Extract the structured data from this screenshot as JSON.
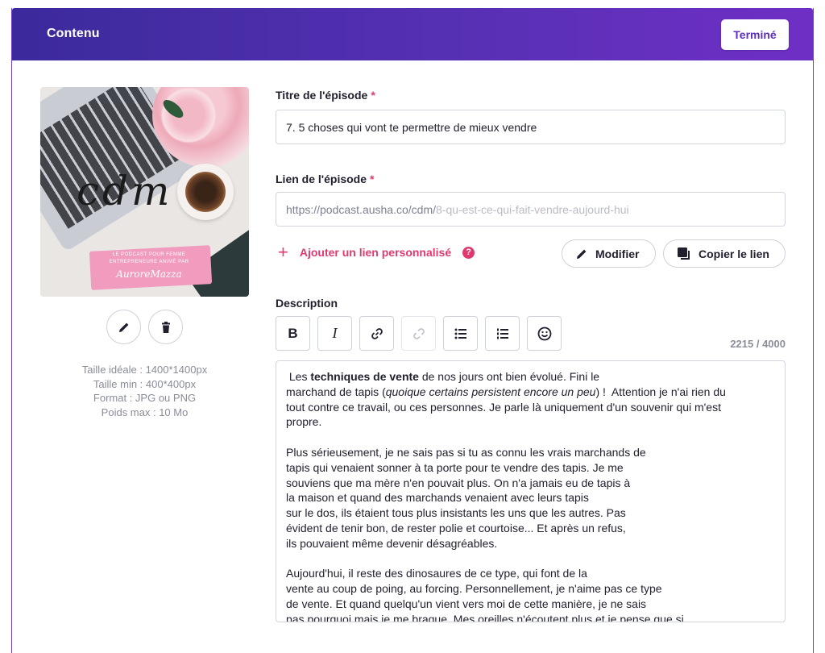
{
  "header": {
    "title": "Contenu",
    "done_label": "Terminé"
  },
  "cover": {
    "logo_text": "cdm",
    "tagline_line1": "LE PODCAST POUR FEMME",
    "tagline_line2": "ENTREPRENEURE ANIMÉ PAR",
    "author": "AuroreMazza"
  },
  "image_info": {
    "ideal_size": "Taille idéale : 1400*1400px",
    "min_size": "Taille min : 400*400px",
    "format": "Format : JPG ou PNG",
    "max_weight": "Poids max : 10 Mo"
  },
  "title_field": {
    "label": "Titre de l'épisode",
    "required_mark": "*",
    "value": "7. 5 choses qui vont te permettre de mieux vendre"
  },
  "link_field": {
    "label": "Lien de l'épisode",
    "required_mark": "*",
    "prefix": "https://podcast.ausha.co/cdm/",
    "suffix": "8-qu-est-ce-qui-fait-vendre-aujourd-hui"
  },
  "actions": {
    "add_custom_link": "Ajouter un lien personnalisé",
    "help": "?",
    "modify": "Modifier",
    "copy_link": "Copier le lien"
  },
  "description": {
    "label": "Description",
    "counter": "2215 / 4000",
    "toolbar": [
      "bold",
      "italic",
      "link",
      "unlink",
      "bullet-list",
      "numbered-list",
      "emoji"
    ],
    "p1_a": " Les ",
    "p1_bold": "techniques de vente",
    "p1_b": " de nos jours ont bien évolué. Fini le",
    "p1_c": "marchand de tapis (",
    "p1_italic": "quoique certains persistent encore un peu",
    "p1_d": ") !  Attention je n'ai rien du",
    "p1_e": "tout contre ce travail, ou ces personnes. Je parle là uniquement d'un souvenir qui m'est",
    "p1_f": "propre.",
    "p2_l1": "Plus sérieusement, je ne sais pas si tu as connu les vrais marchands de",
    "p2_l2": "tapis qui venaient sonner à ta porte pour te vendre des tapis. Je me",
    "p2_l3": "souviens que ma mère n'en pouvait plus. On n'a jamais eu de tapis à",
    "p2_l4": "la maison et quand des marchands venaient avec leurs tapis",
    "p2_l5": "sur le dos, ils étaient tous plus insistants les uns que les autres. Pas",
    "p2_l6": "évident de tenir bon, de rester polie et courtoise... Et après un refus,",
    "p2_l7": "ils pouvaient même devenir désagréables.",
    "p3_l1": "Aujourd'hui, il reste des dinosaures de ce type, qui font de la",
    "p3_l2": "vente au coup de poing, au forcing. Personnellement, je n'aime pas ce type",
    "p3_l3": "de vente. Et quand quelqu'un vient vers moi de cette manière, je ne sais",
    "p3_l4": "pas pourquoi mais je me braque. Mes oreilles n'écoutent plus et je pense que si"
  },
  "colors": {
    "accent": "#5b2fbf",
    "pink": "#e0396f",
    "header_start": "#3b2a9c",
    "header_end": "#6f2fc6"
  }
}
